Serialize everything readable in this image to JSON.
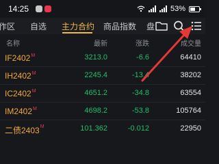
{
  "status_bar": {
    "time": "14:25",
    "battery": "53%"
  },
  "tabs": [
    {
      "label": "作区"
    },
    {
      "label": "自选"
    },
    {
      "label": "主力合约",
      "active": true
    },
    {
      "label": "商品指数"
    },
    {
      "label": "盘"
    }
  ],
  "toolbar_icons": [
    "folder-icon",
    "search-icon",
    "menu-list-icon"
  ],
  "table": {
    "headers": {
      "name": "名称",
      "price": "最新",
      "change": "涨跌",
      "volume": "成交量"
    },
    "rows": [
      {
        "name": "IF2402",
        "marker": "M",
        "price": "3213.0",
        "change": "-6.6",
        "volume": "64410"
      },
      {
        "name": "IH2402",
        "marker": "M",
        "price": "2245.4",
        "change": "-13.4",
        "volume": "38202"
      },
      {
        "name": "IC2402",
        "marker": "M",
        "price": "4651.2",
        "change": "-34.8",
        "volume": "63554"
      },
      {
        "name": "IM2402",
        "marker": "M",
        "price": "4698.2",
        "change": "-53.8",
        "volume": "105764"
      },
      {
        "name": "二债2403",
        "marker": "M",
        "price": "101.362",
        "change": "-0.012",
        "volume": "22950"
      }
    ]
  },
  "colors": {
    "accent": "#f2b84b",
    "down": "#1fbf6a",
    "marker": "#e5384f",
    "annotation_arrow": "#e53935"
  }
}
